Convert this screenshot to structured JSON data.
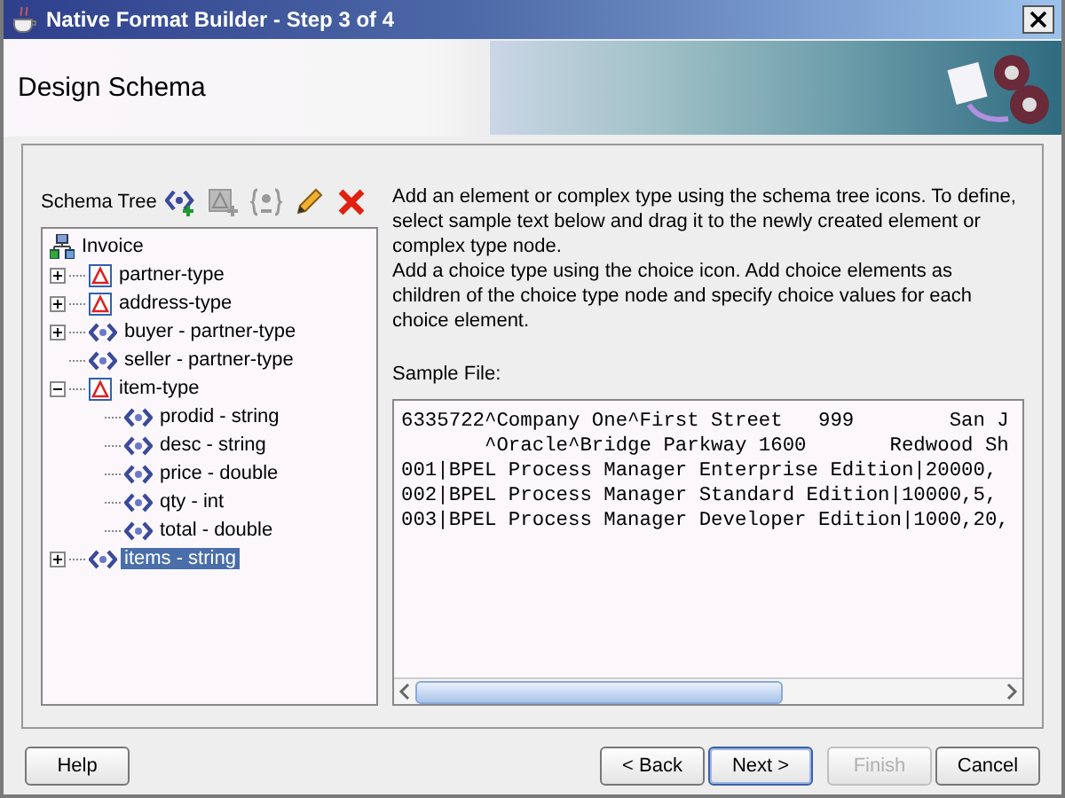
{
  "window": {
    "title": "Native Format Builder - Step 3 of 4"
  },
  "header": {
    "title": "Design Schema"
  },
  "schema_tree": {
    "label": "Schema Tree",
    "tools": [
      {
        "kind": "add-element",
        "disabled": false
      },
      {
        "kind": "add-complex",
        "disabled": true
      },
      {
        "kind": "add-choice",
        "disabled": true
      },
      {
        "kind": "edit",
        "disabled": false
      },
      {
        "kind": "delete",
        "disabled": false
      }
    ],
    "root": {
      "kind": "root",
      "label": "Invoice",
      "children": [
        {
          "kind": "complex",
          "label": "partner-type",
          "expandable": true,
          "expanded": false,
          "selected": false
        },
        {
          "kind": "complex",
          "label": "address-type",
          "expandable": true,
          "expanded": false,
          "selected": false
        },
        {
          "kind": "element",
          "label": "buyer - partner-type",
          "expandable": true,
          "expanded": false,
          "selected": false
        },
        {
          "kind": "element",
          "label": "seller - partner-type",
          "expandable": false,
          "selected": false
        },
        {
          "kind": "complex",
          "label": "item-type",
          "expandable": true,
          "expanded": true,
          "selected": false,
          "children": [
            {
              "kind": "element",
              "label": "prodid - string",
              "expandable": false,
              "selected": false
            },
            {
              "kind": "element",
              "label": "desc - string",
              "expandable": false,
              "selected": false
            },
            {
              "kind": "element",
              "label": "price - double",
              "expandable": false,
              "selected": false
            },
            {
              "kind": "element",
              "label": "qty - int",
              "expandable": false,
              "selected": false
            },
            {
              "kind": "element",
              "label": "total - double",
              "expandable": false,
              "selected": false
            }
          ]
        },
        {
          "kind": "element",
          "label": "items - string",
          "expandable": true,
          "expanded": false,
          "selected": true
        }
      ]
    }
  },
  "instructions": [
    "Add an element or complex type using the schema tree icons. To define, select sample text below and drag it to the newly created element or complex type node.",
    "Add a choice type using the choice icon. Add choice elements as children of the choice type node and specify choice values for each choice element."
  ],
  "sample_file": {
    "label": "Sample File:",
    "lines": [
      "6335722^Company One^First Street   999        San J",
      "       ^Oracle^Bridge Parkway 1600       Redwood Sh",
      "001|BPEL Process Manager Enterprise Edition|20000,",
      "002|BPEL Process Manager Standard Edition|10000,5,",
      "003|BPEL Process Manager Developer Edition|1000,20,"
    ]
  },
  "buttons": [
    {
      "label": "Help",
      "kind": "help",
      "disabled": false,
      "default": false
    },
    {
      "label": "< Back",
      "kind": "nav",
      "disabled": false,
      "default": false
    },
    {
      "label": "Next >",
      "kind": "nav",
      "disabled": false,
      "default": true
    },
    {
      "label": "Finish",
      "kind": "nav",
      "disabled": true,
      "default": false
    },
    {
      "label": "Cancel",
      "kind": "cancel",
      "disabled": false,
      "default": false
    }
  ]
}
